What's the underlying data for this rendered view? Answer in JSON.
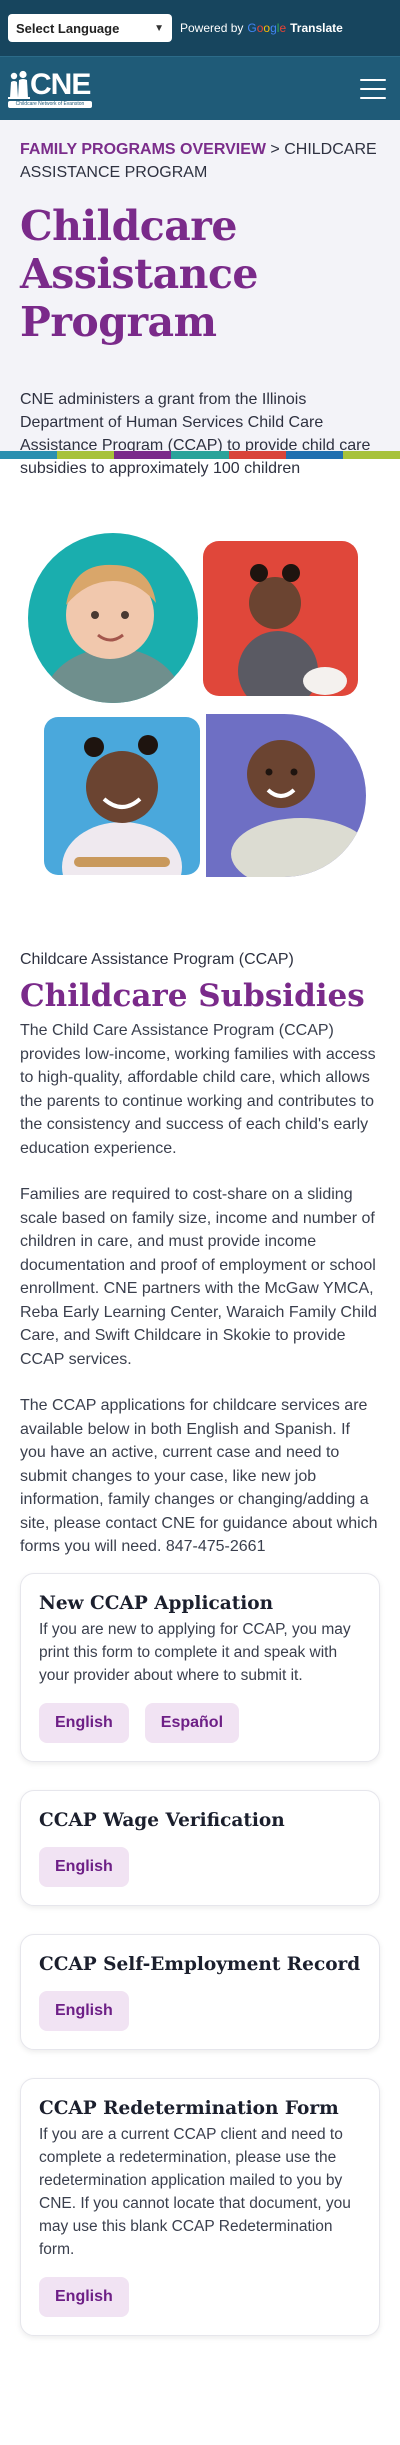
{
  "translate": {
    "select_label": "Select Language",
    "powered_by": "Powered by",
    "google_letters": [
      "G",
      "o",
      "o",
      "g",
      "l",
      "e"
    ],
    "google_colors": [
      "#4285f4",
      "#ea4335",
      "#fbbc05",
      "#4285f4",
      "#34a853",
      "#ea4335"
    ],
    "translate_word": "Translate"
  },
  "header": {
    "logo_text": "CNE",
    "logo_tagline": "Childcare Network of Evanston",
    "menu_icon": "hamburger-icon"
  },
  "hero": {
    "breadcrumb_link": "FAMILY PROGRAMS OVERVIEW",
    "breadcrumb_sep": " > ",
    "breadcrumb_current": "CHILDCARE ASSISTANCE PROGRAM",
    "title": "Childcare Assistance Program",
    "description": "CNE administers a grant from the Illinois Department of Human Services Child Care Assistance Program (CCAP) to provide child care subsidies to approximately 100 children"
  },
  "stripe_colors": [
    "#2a8fb0",
    "#a7c23a",
    "#7a2a8a",
    "#2aa39a",
    "#d9443a",
    "#1f6fb0",
    "#a7c23a"
  ],
  "photo_bg_colors": [
    "#1aaeae",
    "#e0473a",
    "#4aa8dc",
    "#6e6fc4"
  ],
  "content": {
    "eyebrow": "Childcare Assistance Program (CCAP)",
    "title": "Childcare Subsidies",
    "paragraphs": [
      "The Child Care Assistance Program (CCAP) provides low-income, working families with access to high-quality, affordable child care, which allows the parents to continue working and contributes to the consistency and success of each child's early education experience.",
      "Families are required to cost-share on a sliding scale based on family size, income and number of children in care, and must provide income documentation and proof of employment or school enrollment. CNE partners with the McGaw YMCA, Reba Early Learning Center, Waraich Family Child Care, and Swift Childcare in Skokie to provide CCAP services.",
      "The CCAP applications for childcare services are available below in both English and Spanish. If you have an active, current case and need to submit changes to your case, like new job information, family changes or changing/adding a site, please contact CNE for guidance about which forms you will need. 847-475-2661"
    ]
  },
  "forms": [
    {
      "title": "New CCAP Application",
      "text": "If you are new to applying for CCAP, you may print this form to complete it and speak with your provider about where to submit it.",
      "buttons": [
        "English",
        "Español"
      ]
    },
    {
      "title": "CCAP Wage Verification",
      "text": "",
      "buttons": [
        "English"
      ]
    },
    {
      "title": "CCAP Self-Employment Record",
      "text": "",
      "buttons": [
        "English"
      ]
    },
    {
      "title": "CCAP Redetermination Form",
      "text": "If you are a current CCAP client and need to complete a redetermination, please use the redetermination application mailed to you by CNE. If you cannot locate that document, you may use this blank CCAP Redetermination form.",
      "buttons": [
        "English"
      ]
    }
  ]
}
